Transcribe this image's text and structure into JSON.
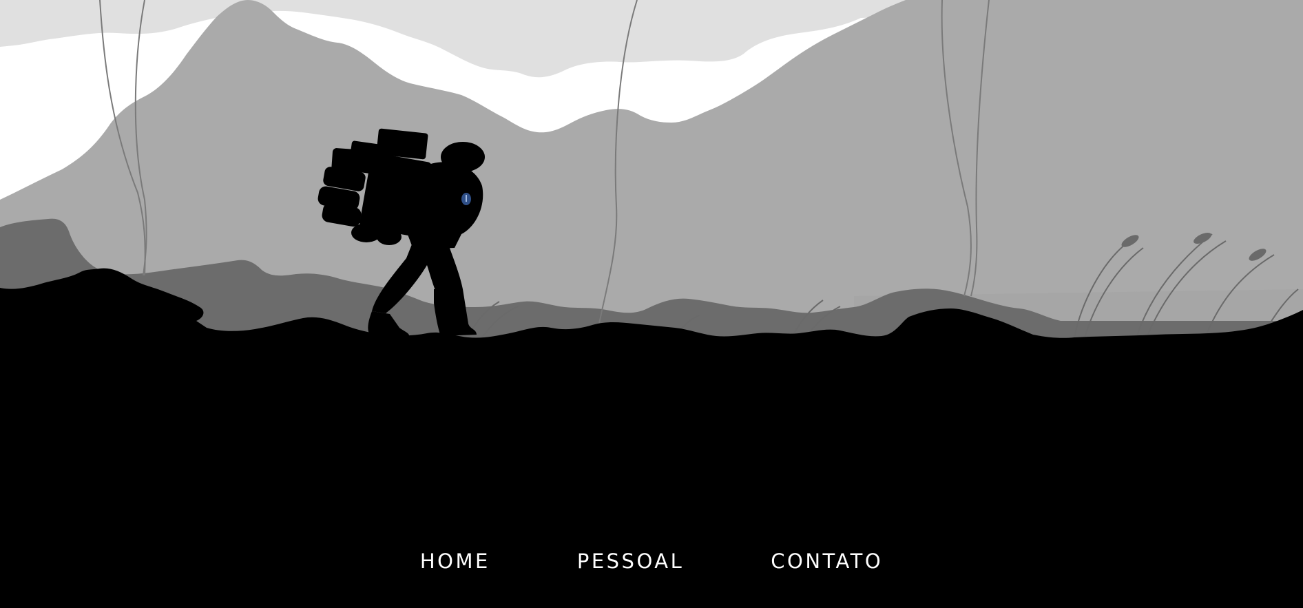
{
  "hero": {
    "image": "silhouette-hiker-landscape",
    "palette": {
      "sky": "#ffffff",
      "clouds": "#e0e0e0",
      "mountains_far": "#aaaaaa",
      "hills_mid": "#6c6c6c",
      "ground": "#000000",
      "backpack_emblem": "#2f4f87"
    }
  },
  "nav": {
    "items": [
      {
        "label": "HOME"
      },
      {
        "label": "PESSOAL"
      },
      {
        "label": "CONTATO"
      }
    ],
    "text_color": "#ffffff",
    "background": "#000000"
  }
}
